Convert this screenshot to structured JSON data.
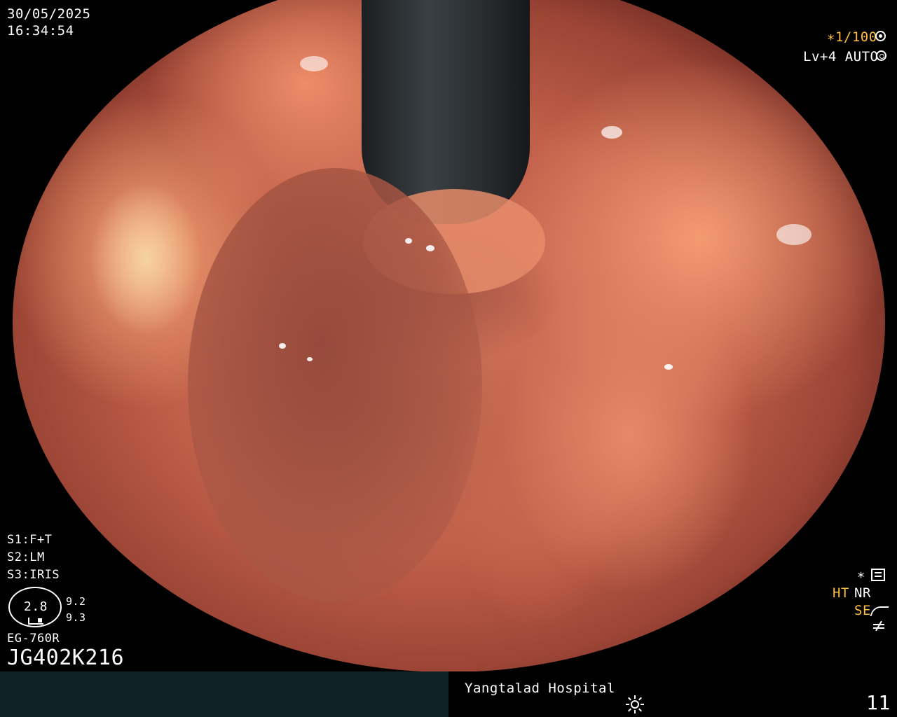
{
  "overlay": {
    "date": "30/05/2025",
    "time": "16:34:54",
    "shutter": "∗1/100",
    "shutter_icon": "aperture-icon",
    "level_auto": "Lv+4 AUTO",
    "auto_icon": "iris-icon",
    "s1": "S1:F+T",
    "s2": "S2:LM",
    "s3": "S3:IRIS",
    "zoom_value": "2.8",
    "zoom_side_1": "9.2",
    "zoom_side_2": "9.3",
    "scope_model": "EG-760R",
    "scope_serial": "JG402K216",
    "star_mark": "∗",
    "ht": "HT",
    "nr": "NR",
    "se": "SE"
  },
  "footer": {
    "hospital": "Yangtalad Hospital",
    "brightness_icon": "sun-icon",
    "image_number": "11"
  },
  "colors": {
    "amber": "#ffbf3c",
    "footer_panel": "#0f2326",
    "mucosa": "#d2735a"
  }
}
